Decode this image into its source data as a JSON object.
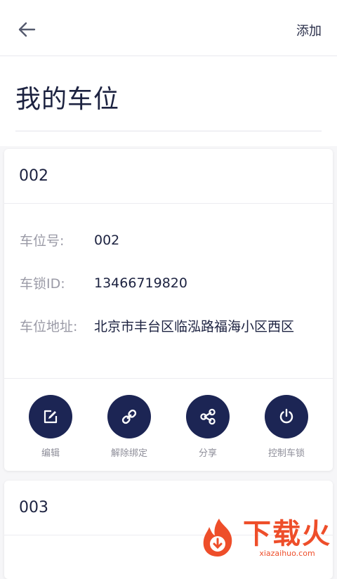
{
  "header": {
    "add_label": "添加"
  },
  "page": {
    "title": "我的车位"
  },
  "cards": [
    {
      "title": "002",
      "fields": [
        {
          "label": "车位号:",
          "value": "002"
        },
        {
          "label": "车锁ID:",
          "value": "13466719820"
        },
        {
          "label": "车位地址:",
          "value": "北京市丰台区临泓路福海小区西区"
        }
      ],
      "actions": [
        {
          "label": "编辑",
          "icon": "edit-icon"
        },
        {
          "label": "解除绑定",
          "icon": "link-icon"
        },
        {
          "label": "分享",
          "icon": "share-icon"
        },
        {
          "label": "控制车锁",
          "icon": "power-icon"
        }
      ]
    },
    {
      "title": "003"
    }
  ],
  "watermark": {
    "cn": "下载火",
    "en": "xiazaihuo.com"
  },
  "colors": {
    "accent": "#1c2554",
    "watermark": "#ee4e2a"
  }
}
